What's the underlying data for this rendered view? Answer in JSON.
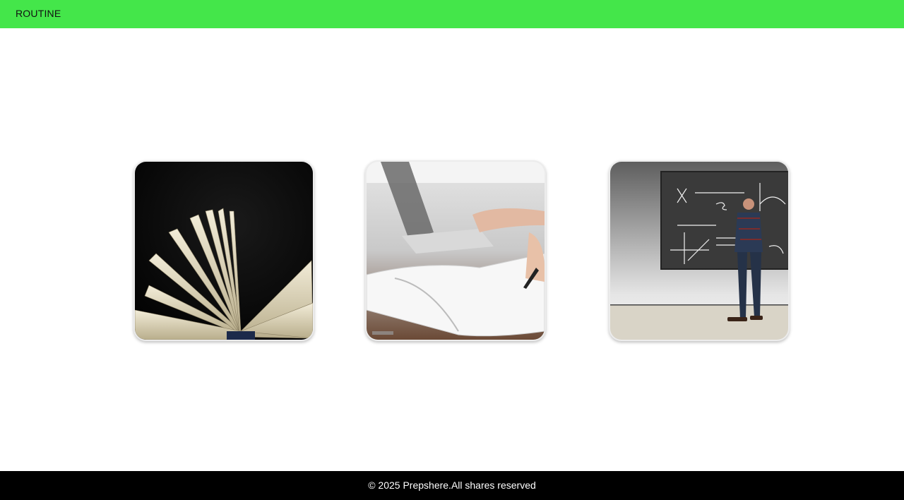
{
  "header": {
    "title": "ROUTINE",
    "color": "#44e64a"
  },
  "cards": [
    {
      "name": "open-book-image",
      "icon": "open-book"
    },
    {
      "name": "notebook-writing-image",
      "icon": "pen-and-notebook"
    },
    {
      "name": "chalkboard-math-image",
      "icon": "chalkboard"
    }
  ],
  "footer": {
    "copyright": "© 2025 Prepshere.All shares reserved"
  }
}
